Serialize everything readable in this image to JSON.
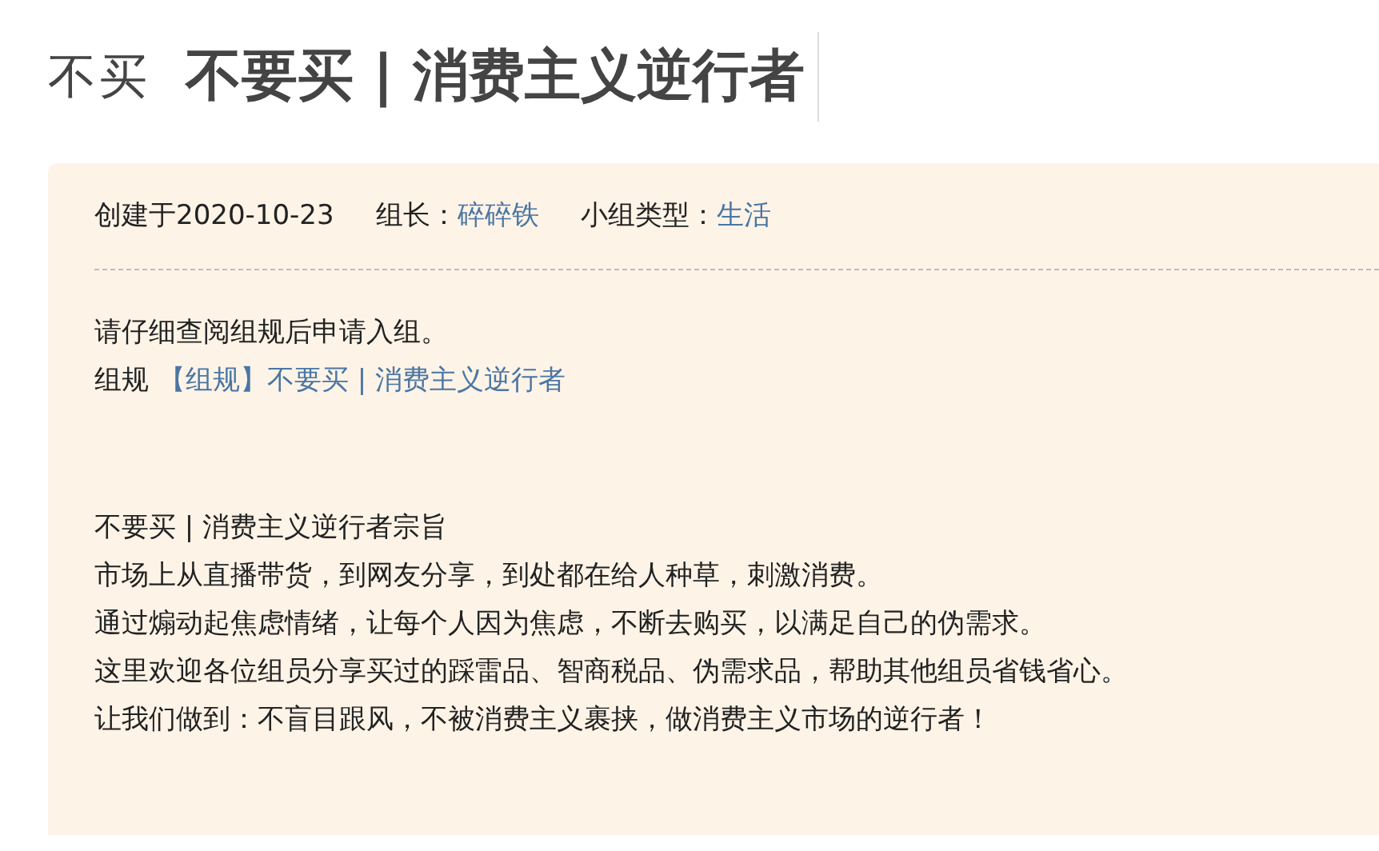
{
  "header": {
    "logo": "不买",
    "title": "不要买 | 消费主义逆行者"
  },
  "info": {
    "created": "创建于2020-10-23",
    "leader_label": "组长：",
    "leader": "碎碎铁",
    "type_label": "小组类型：",
    "type": "生活"
  },
  "notice": "请仔细查阅组规后申请入组。",
  "rules": {
    "label": "组规",
    "link": "【组规】不要买 | 消费主义逆行者"
  },
  "description": [
    "不要买 | 消费主义逆行者宗旨",
    "市场上从直播带货，到网友分享，到处都在给人种草，刺激消费。",
    "通过煽动起焦虑情绪，让每个人因为焦虑，不断去购买，以满足自己的伪需求。",
    "这里欢迎各位组员分享买过的踩雷品、智商税品、伪需求品，帮助其他组员省钱省心。",
    "让我们做到：不盲目跟风，不被消费主义裹挟，做消费主义市场的逆行者！"
  ]
}
